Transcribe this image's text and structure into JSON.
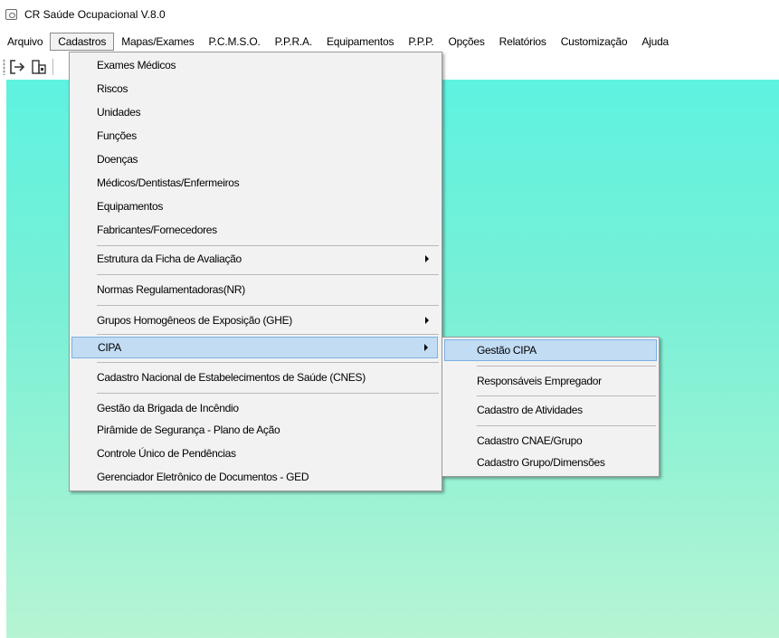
{
  "window": {
    "title": "CR Saúde Ocupacional V.8.0"
  },
  "menubar": {
    "items": [
      "Arquivo",
      "Cadastros",
      "Mapas/Exames",
      "P.C.M.S.O.",
      "P.P.R.A.",
      "Equipamentos",
      "P.P.P.",
      "Opções",
      "Relatórios",
      "Customização",
      "Ajuda"
    ]
  },
  "cadastros_menu": {
    "items": [
      "Exames Médicos",
      "Riscos",
      "Unidades",
      "Funções",
      "Doenças",
      "Médicos/Dentistas/Enfermeiros",
      "Equipamentos",
      "Fabricantes/Fornecedores",
      "Estrutura da Ficha de Avaliação",
      "Normas Regulamentadoras(NR)",
      "Grupos Homogêneos de Exposição (GHE)",
      "CIPA",
      "Cadastro Nacional de Estabelecimentos de Saúde (CNES)",
      "Gestão da Brigada de Incêndio",
      "Pirâmide de Segurança - Plano de Ação",
      "Controle Único de Pendências",
      "Gerenciador Eletrônico de Documentos - GED"
    ]
  },
  "cipa_submenu": {
    "items": [
      "Gestão CIPA",
      "Responsáveis Empregador",
      "Cadastro de Atividades",
      "Cadastro CNAE/Grupo",
      "Cadastro Grupo/Dimensões"
    ]
  },
  "colors": {
    "highlight": "#c2dcf4",
    "highlight_border": "#7cb0e2",
    "background_top": "#5ef2e0",
    "background_bottom": "#b6f4d3"
  },
  "icons": {
    "app": "app-icon",
    "toolbar": [
      "exit-icon",
      "building-icon"
    ]
  }
}
